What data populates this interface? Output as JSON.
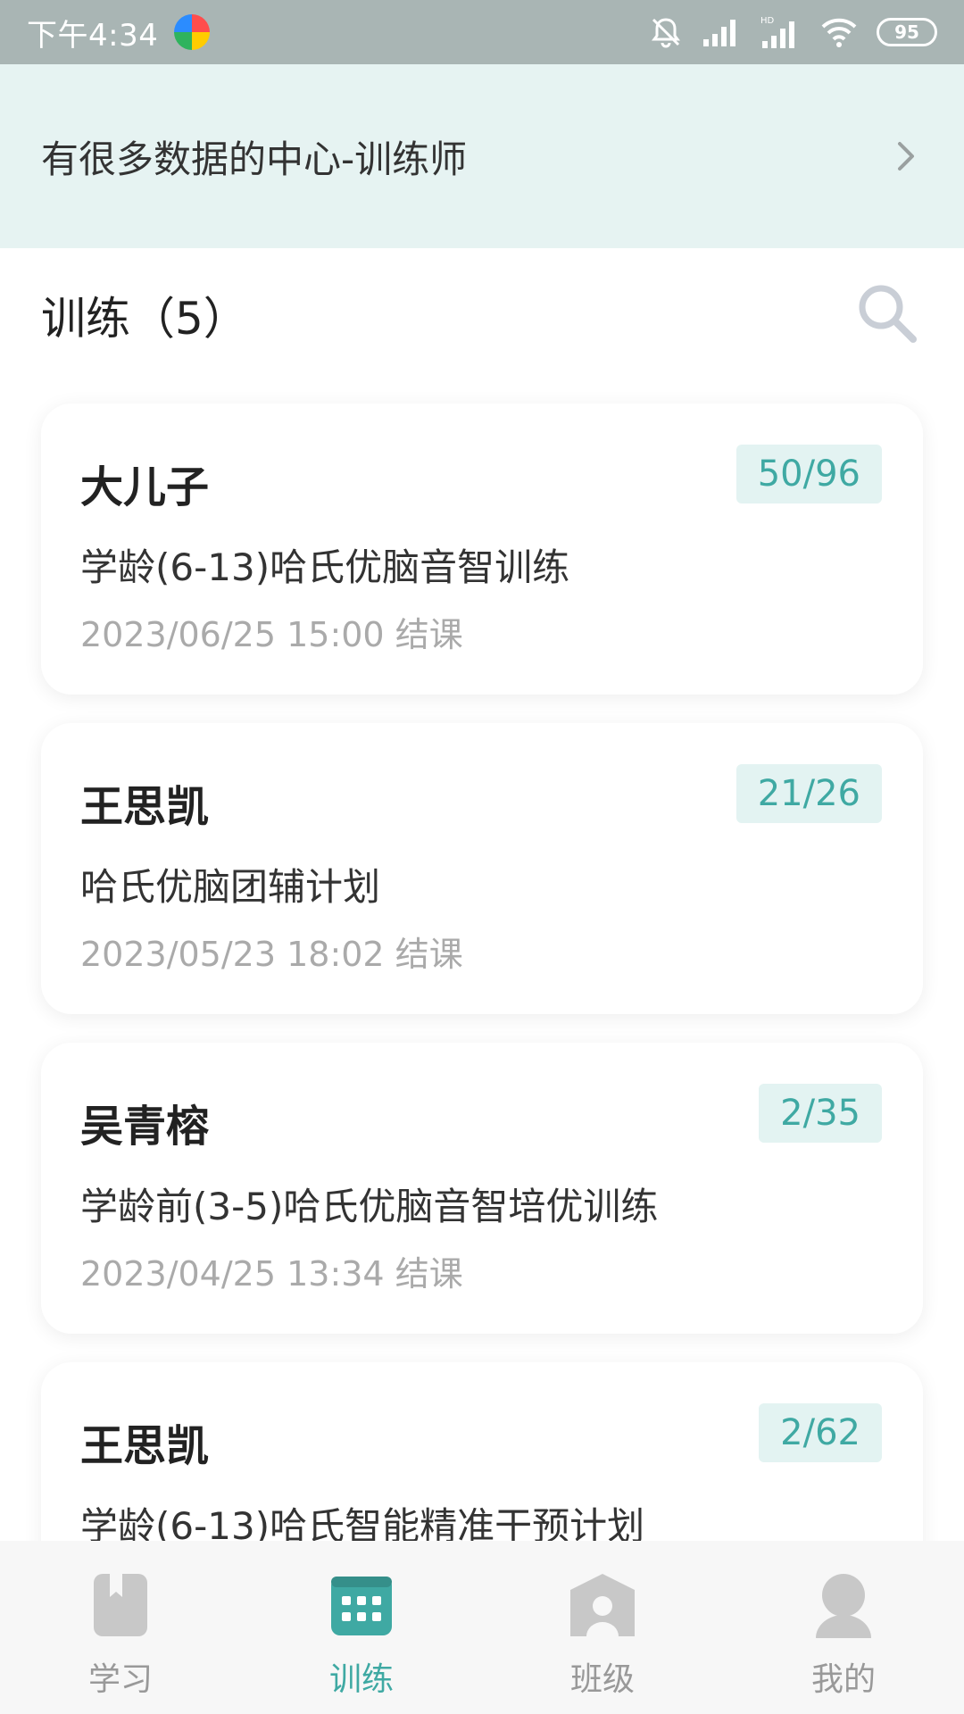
{
  "status_bar": {
    "time": "下午4:34",
    "battery": "95"
  },
  "org": {
    "title": "有很多数据的中心-训练师"
  },
  "section": {
    "title": "训练（5）"
  },
  "cards": [
    {
      "name": "大儿子",
      "badge": "50/96",
      "course": "学龄(6-13)哈氏优脑音智训练",
      "date": "2023/06/25 15:00 结课"
    },
    {
      "name": "王思凯",
      "badge": "21/26",
      "course": "哈氏优脑团辅计划",
      "date": "2023/05/23 18:02 结课"
    },
    {
      "name": "吴青榕",
      "badge": "2/35",
      "course": "学龄前(3-5)哈氏优脑音智培优训练",
      "date": "2023/04/25 13:34 结课"
    },
    {
      "name": "王思凯",
      "badge": "2/62",
      "course": "学龄(6-13)哈氏智能精准干预计划",
      "date": ""
    }
  ],
  "nav": {
    "items": [
      {
        "label": "学习",
        "icon": "book-icon"
      },
      {
        "label": "训练",
        "icon": "calendar-grid-icon"
      },
      {
        "label": "班级",
        "icon": "class-house-icon"
      },
      {
        "label": "我的",
        "icon": "user-icon"
      }
    ],
    "active_index": 1
  },
  "colors": {
    "accent": "#3fa9a3",
    "header_bg": "#e6f3f2",
    "status_bar_bg": "#a9b5b4",
    "inactive": "#c8c8c8"
  }
}
